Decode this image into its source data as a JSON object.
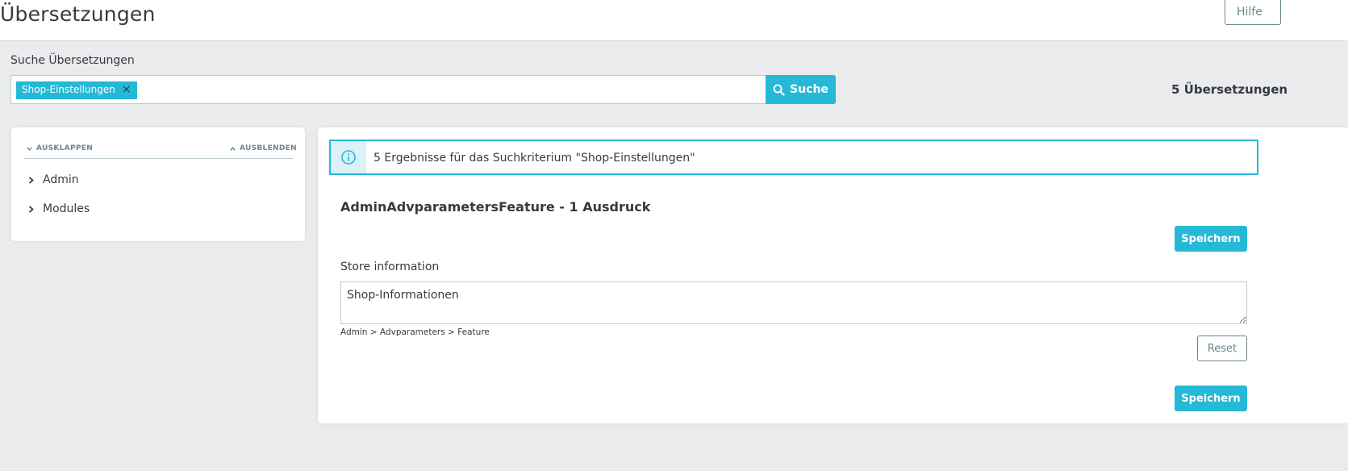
{
  "header": {
    "title": "Übersetzungen",
    "help_label": "Hilfe"
  },
  "search": {
    "label": "Suche Übersetzungen",
    "chip_label": "Shop-Einstellungen",
    "chip_close": "×",
    "button_label": "Suche",
    "result_count": "5 Übersetzungen"
  },
  "tree": {
    "expand_label": "AUSKLAPPEN",
    "collapse_label": "AUSBLENDEN",
    "items": [
      {
        "label": "Admin"
      },
      {
        "label": "Modules"
      }
    ]
  },
  "main": {
    "alert_text": "5 Ergebnisse für das Suchkriterium \"Shop-Einstellungen\"",
    "domain_title": "AdminAdvparametersFeature - 1 Ausdruck",
    "save_label": "Speichern",
    "field_label": "Store information",
    "field_value": "Shop-Informationen",
    "breadcrumb": "Admin > Advparameters > Feature",
    "reset_label": "Reset"
  },
  "colors": {
    "accent": "#25b9d7",
    "background": "#eaebec",
    "text": "#363a41",
    "muted": "#6c868e"
  }
}
